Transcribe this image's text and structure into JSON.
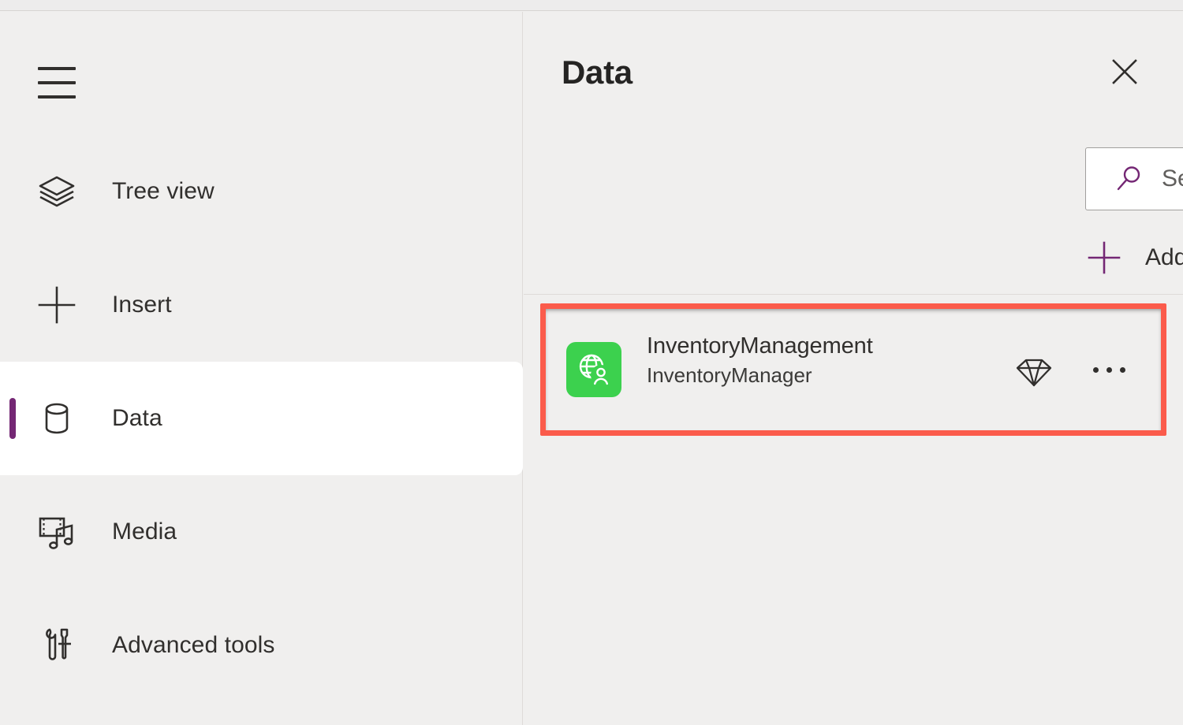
{
  "app": {
    "background_color": "#f0efee",
    "accent_purple": "#742774",
    "highlight_red": "#fb5b4b",
    "connector_green": "#3cd14e"
  },
  "sidebar": {
    "menu_button": {
      "icon": "hamburger-menu-icon"
    },
    "items": [
      {
        "label": "Tree view",
        "icon": "layers-icon",
        "selected": false
      },
      {
        "label": "Insert",
        "icon": "plus-icon",
        "selected": false
      },
      {
        "label": "Data",
        "icon": "database-icon",
        "selected": true
      },
      {
        "label": "Media",
        "icon": "media-icon",
        "selected": false
      },
      {
        "label": "Advanced tools",
        "icon": "tools-icon",
        "selected": false
      }
    ]
  },
  "panel": {
    "title": "Data",
    "close_icon": "close-icon",
    "search": {
      "placeholder": "Search",
      "value": "",
      "icon": "search-icon"
    },
    "add_data": {
      "label": "Add data",
      "plus_icon": "plus-icon",
      "chevron_icon": "chevron-down-icon"
    },
    "data_sources": [
      {
        "name": "InventoryManagement",
        "subtitle": "InventoryManager",
        "icon": "globe-user-connector-icon",
        "icon_color": "#3cd14e",
        "premium_icon": "premium-diamond-icon",
        "more_icon": "more-options-icon",
        "highlighted": true
      }
    ]
  }
}
